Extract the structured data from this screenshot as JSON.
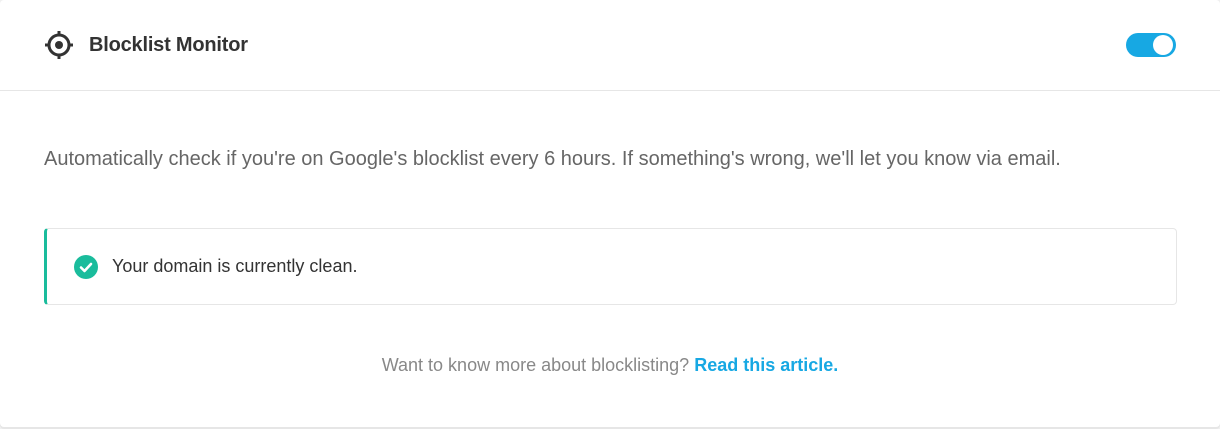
{
  "header": {
    "title": "Blocklist Monitor",
    "icon": "target-icon",
    "toggle_on": true,
    "accent_color": "#17a8e3"
  },
  "body": {
    "description": "Automatically check if you're on Google's blocklist every 6 hours. If something's wrong, we'll let you know via email.",
    "notice": {
      "icon": "check-circle-icon",
      "text": "Your domain is currently clean.",
      "status_color": "#1abc9c"
    },
    "footer": {
      "prompt": "Want to know more about blocklisting?",
      "link_label": "Read this article."
    }
  }
}
